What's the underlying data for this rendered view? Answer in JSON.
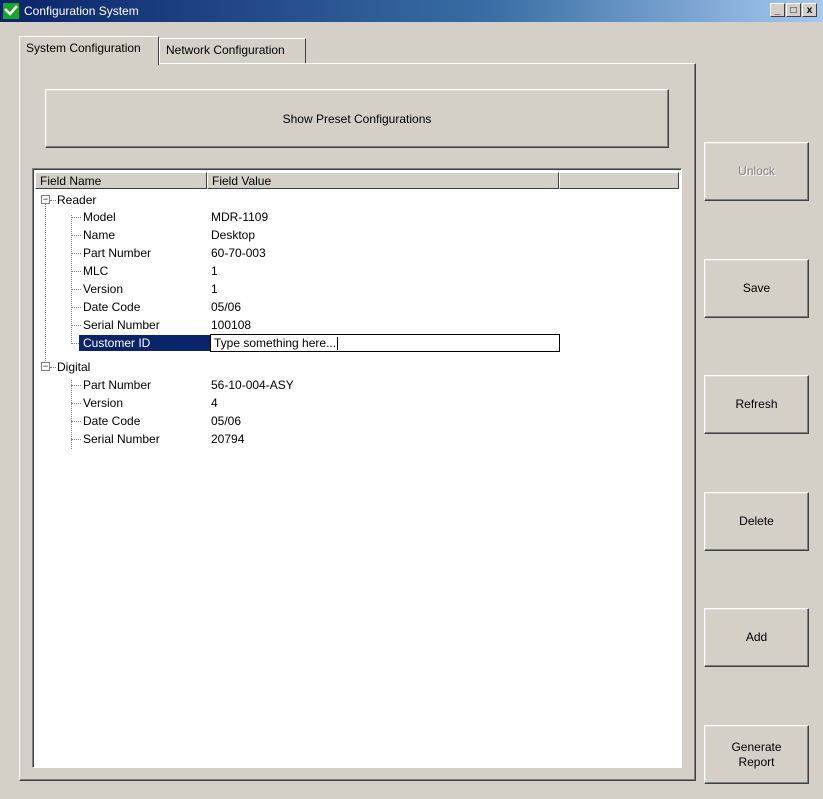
{
  "window": {
    "title": "Configuration System",
    "controls": {
      "minimize": "_",
      "maximize": "□",
      "close": "x"
    }
  },
  "tabs": [
    {
      "label": "System Configuration",
      "active": true
    },
    {
      "label": "Network Configuration",
      "active": false
    }
  ],
  "preset_button": "Show Preset Configurations",
  "grid": {
    "columns": [
      "Field Name",
      "Field Value",
      ""
    ],
    "groups": [
      {
        "name": "Reader",
        "expanded": true,
        "rows": [
          {
            "field": "Model",
            "value": "MDR-1109"
          },
          {
            "field": "Name",
            "value": "Desktop"
          },
          {
            "field": "Part Number",
            "value": "60-70-003"
          },
          {
            "field": "MLC",
            "value": "1"
          },
          {
            "field": "Version",
            "value": "1"
          },
          {
            "field": "Date Code",
            "value": "05/06"
          },
          {
            "field": "Serial Number",
            "value": "100108"
          },
          {
            "field": "Customer ID",
            "value": "",
            "selected": true
          }
        ]
      },
      {
        "name": "Digital",
        "expanded": true,
        "rows": [
          {
            "field": "Part Number",
            "value": "56-10-004-ASY"
          },
          {
            "field": "Version",
            "value": "4"
          },
          {
            "field": "Date Code",
            "value": "05/06"
          },
          {
            "field": "Serial Number",
            "value": "20794"
          }
        ]
      }
    ],
    "edit_placeholder": "Type something here..."
  },
  "side_buttons": {
    "unlock": {
      "label": "Unlock",
      "enabled": false
    },
    "save": {
      "label": "Save",
      "enabled": true
    },
    "refresh": {
      "label": "Refresh",
      "enabled": true
    },
    "delete": {
      "label": "Delete",
      "enabled": true
    },
    "add": {
      "label": "Add",
      "enabled": true
    },
    "generate_report": {
      "label": "Generate\nReport",
      "enabled": true
    }
  },
  "colors": {
    "selection": "#0a246a",
    "face": "#d4d0c8",
    "title_gradient": [
      "#0a246a",
      "#a6caf0"
    ]
  }
}
